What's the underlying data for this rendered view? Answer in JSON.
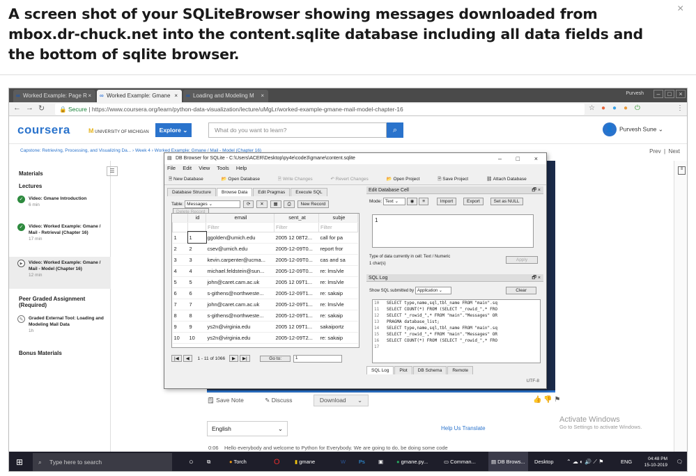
{
  "question": {
    "title": "A screen shot of your SQLiteBrowser showing messages downloaded from mbox.dr-chuck.net into the content.sqlite database including all data fields and the bottom of sqlite browser.",
    "close": "×"
  },
  "browser": {
    "tabs": [
      {
        "label": "Worked Example: Page R"
      },
      {
        "label": "Worked Example: Gmane"
      },
      {
        "label": "Loading and Modeling M"
      }
    ],
    "profile": "Purvesh",
    "secure": "Secure",
    "url": "https://www.coursera.org/learn/python-data-visualization/lecture/uMgLr/worked-example-gmane-mail-model-chapter-16"
  },
  "coursera": {
    "logo": "coursera",
    "university": "UNIVERSITY OF MICHIGAN",
    "explore": "Explore",
    "search_placeholder": "What do you want to learn?",
    "user": "Purvesh Sune",
    "breadcrumb": "Capstone: Retrieving, Processing, and Visualizing Da...  ›  Week 4  ›  Worked Example: Gmane / Mail - Model (Chapter 16)",
    "prev": "Prev",
    "next": "Next",
    "sidebar": {
      "materials": "Materials",
      "lectures": "Lectures",
      "items": [
        {
          "title": "Video: Gmane Introduction",
          "dur": "6 min"
        },
        {
          "title": "Video: Worked Example: Gmane / Mail - Retrieval (Chapter 16)",
          "dur": "17 min"
        },
        {
          "title": "Video: Worked Example: Gmane / Mail - Model (Chapter 16)",
          "dur": "12 min"
        }
      ],
      "peer": "Peer Graded Assignment (Required)",
      "tool": {
        "title": "Graded External Tool: Loading and Modeling Mail Data",
        "dur": "1h"
      },
      "bonus": "Bonus Materials"
    },
    "save_note": "Save Note",
    "discuss": "Discuss",
    "download": "Download",
    "language": "English",
    "help_translate": "Help Us Translate",
    "activate_title": "Activate Windows",
    "activate_sub": "Go to Settings to activate Windows.",
    "transcript_time": "0:06",
    "transcript": "Hello everybody and welcome to Python for Everybody. We are going to do, be doing some code"
  },
  "dbbrowser": {
    "title": "DB Browser for SQLite - C:\\Users\\ACER\\Desktop\\py4e\\code3\\gmane\\content.sqlite",
    "menu": [
      "File",
      "Edit",
      "View",
      "Tools",
      "Help"
    ],
    "toolbar": [
      "New Database",
      "Open Database",
      "Write Changes",
      "Revert Changes",
      "Open Project",
      "Save Project",
      "Attach Database"
    ],
    "tabs": [
      "Database Structure",
      "Browse Data",
      "Edit Pragmas",
      "Execute SQL"
    ],
    "table_label": "Table:",
    "table_value": "Messages",
    "new_record": "New Record",
    "delete_record": "Delete Record",
    "columns": [
      "id",
      "email",
      "sent_at",
      "subje"
    ],
    "filter": "Filter",
    "rows": [
      {
        "n": "1",
        "id": "1",
        "email": "ggolden@umich.edu",
        "sent": "2005 12 08T2...",
        "subj": "call for pa"
      },
      {
        "n": "2",
        "id": "2",
        "email": "csev@umich.edu",
        "sent": "2005-12-09T0...",
        "subj": "report fror"
      },
      {
        "n": "3",
        "id": "3",
        "email": "kevin.carpenter@ucma...",
        "sent": "2005-12-09T0...",
        "subj": "cas and sa"
      },
      {
        "n": "4",
        "id": "4",
        "email": "michael.feldstein@sun...",
        "sent": "2005-12-09T0...",
        "subj": "re: lms/vle"
      },
      {
        "n": "5",
        "id": "5",
        "email": "john@caret.cam.ac.uk",
        "sent": "2005 12 09T1...",
        "subj": "re: lms/vle"
      },
      {
        "n": "6",
        "id": "6",
        "email": "s-githens@northweste...",
        "sent": "2005-12-09T1...",
        "subj": "re: sakaip"
      },
      {
        "n": "7",
        "id": "7",
        "email": "john@caret.cam.ac.uk",
        "sent": "2005-12-09T1...",
        "subj": "re: lms/vle"
      },
      {
        "n": "8",
        "id": "8",
        "email": "s-githens@northweste...",
        "sent": "2005-12-09T1...",
        "subj": "re: sakaip"
      },
      {
        "n": "9",
        "id": "9",
        "email": "ys2n@virginia.edu",
        "sent": "2005 12 09T1...",
        "subj": "sakaiportz"
      },
      {
        "n": "10",
        "id": "10",
        "email": "ys2n@virginia.edu",
        "sent": "2005-12-09T2...",
        "subj": "re: sakaip"
      }
    ],
    "pager_text": "1 - 11 of 1066",
    "goto": "Go to:",
    "goto_value": "1",
    "edit_cell": "Edit Database Cell",
    "mode_label": "Mode:",
    "mode_value": "Text",
    "import": "Import",
    "export": "Export",
    "set_null": "Set as NULL",
    "cell_value": "1",
    "cell_type": "Type of data currently in cell: Text / Numeric",
    "cell_chars": "1 char(s)",
    "apply": "Apply",
    "sql_log": "SQL Log",
    "show_sql": "Show SQL submitted by",
    "submitted_by": "Application",
    "clear": "Clear",
    "log": [
      {
        "n": "10",
        "t": "SELECT type,name,sql,tbl_name FROM \"main\".sq"
      },
      {
        "n": "11",
        "t": "SELECT COUNT(*) FROM (SELECT \"_rowid_\",* FRO"
      },
      {
        "n": "12",
        "t": "SELECT \"_rowid_\",* FROM \"main\".\"Messages\" OR"
      },
      {
        "n": "13",
        "t": "PRAGMA database_list;"
      },
      {
        "n": "14",
        "t": "SELECT type,name,sql,tbl_name FROM \"main\".sq"
      },
      {
        "n": "15",
        "t": "SELECT \"_rowid_\",* FROM \"main\".\"Messages\" OR"
      },
      {
        "n": "16",
        "t": "SELECT COUNT(*) FROM (SELECT \"_rowid_\",* FRO"
      },
      {
        "n": "17",
        "t": ""
      }
    ],
    "bottom_tabs": [
      "SQL Log",
      "Plot",
      "DB Schema",
      "Remote"
    ],
    "encoding": "UTF-8"
  },
  "taskbar": {
    "search": "Type here to search",
    "apps": [
      "Torch",
      "gmane",
      "gmane.py...",
      "Comman...",
      "DB Brows..."
    ],
    "desktop": "Desktop",
    "lang": "ENG",
    "time": "04:48 PM",
    "date": "15-10-2019"
  }
}
